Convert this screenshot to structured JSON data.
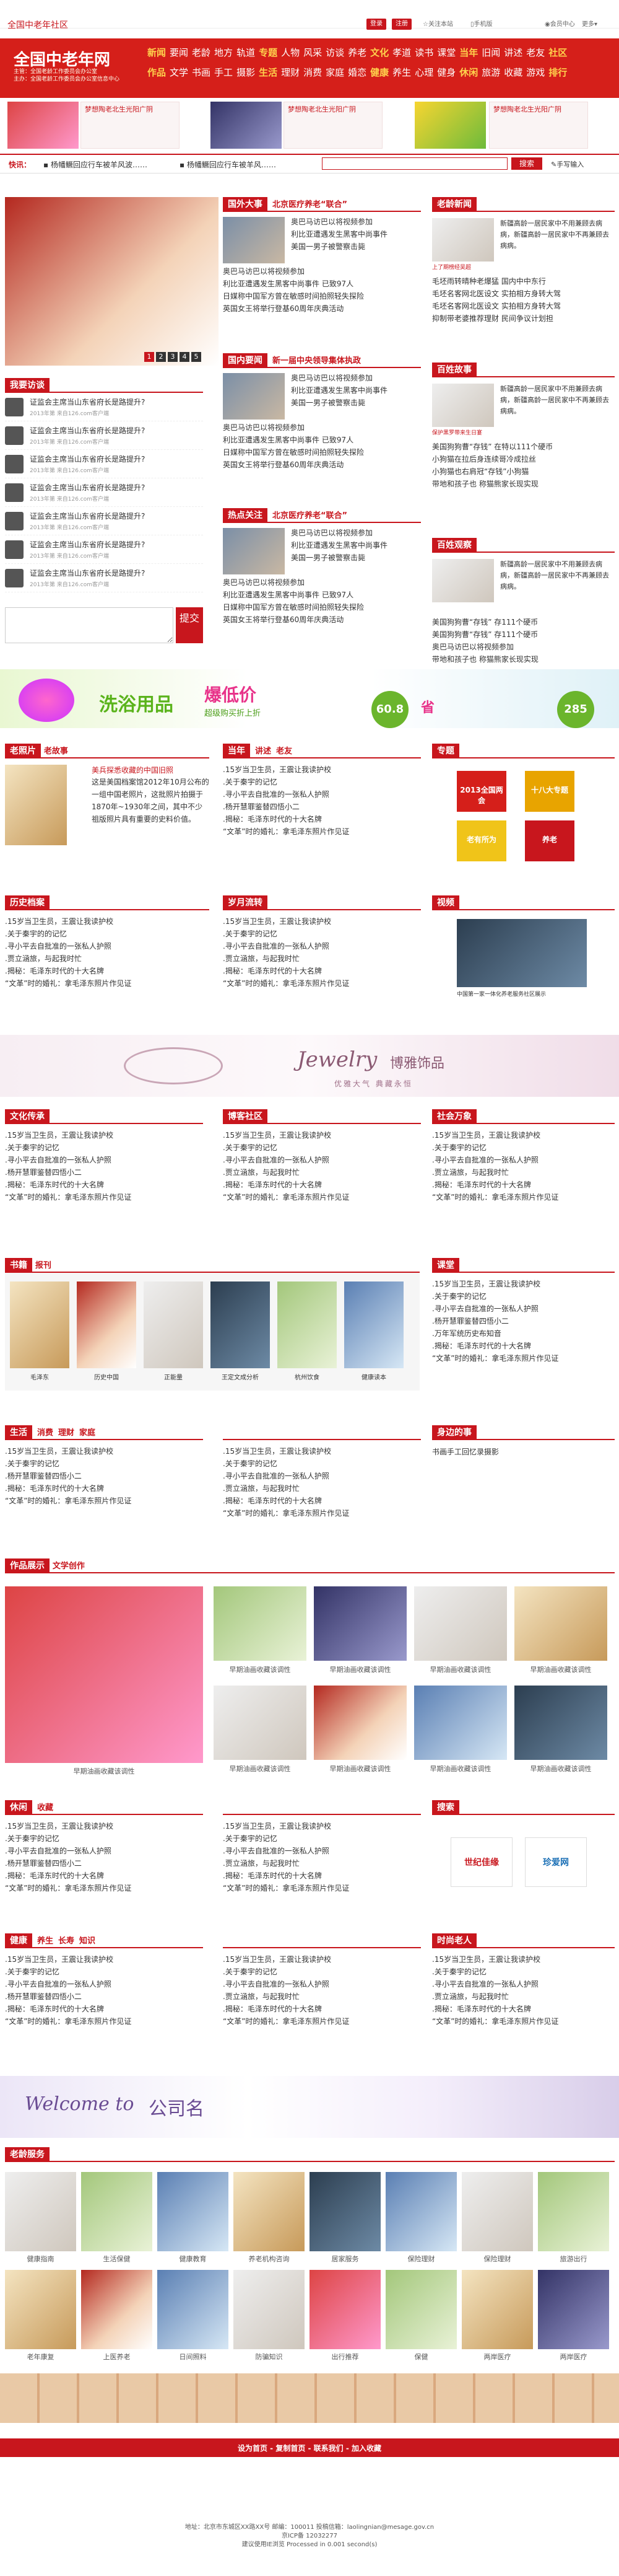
{
  "site": {
    "small_title": "全国中老年社区",
    "logo": "全国中老年网",
    "logo_sub1": "主管：全国老龄工作委员会办公室",
    "logo_sub2": "主办：全国老龄工作委员会办公室信息中心",
    "login_btn": "登录",
    "register_btn": "注册",
    "tools": [
      "关注本站",
      "手机版",
      "订阅"
    ],
    "member_link": "会员中心",
    "more": "更多"
  },
  "nav": {
    "row1": [
      {
        "b": "新闻",
        "items": [
          "要闻",
          "老龄",
          "地方",
          "轨道"
        ]
      },
      {
        "b": "专题",
        "items": [
          "人物",
          "风采",
          "访谈",
          "养老"
        ]
      },
      {
        "b": "文化",
        "items": [
          "孝道",
          "读书",
          "课堂"
        ]
      },
      {
        "b": "当年",
        "items": [
          "旧闻",
          "讲述",
          "老友"
        ]
      },
      {
        "b": "社区",
        "items": []
      }
    ],
    "row2": [
      {
        "b": "作品",
        "items": [
          "文学",
          "书画",
          "手工",
          "摄影"
        ]
      },
      {
        "b": "生活",
        "items": [
          "理财",
          "消费",
          "家庭",
          "婚恋"
        ]
      },
      {
        "b": "健康",
        "items": [
          "养生",
          "心理",
          "健身"
        ]
      },
      {
        "b": "休闲",
        "items": [
          "旅游",
          "收藏",
          "游戏"
        ]
      },
      {
        "b": "排行",
        "items": []
      }
    ]
  },
  "ads": [
    {
      "text": "梦想陶老北生光阳广阴"
    },
    {
      "text": "梦想陶老北生光阳广阴"
    },
    {
      "text": "梦想陶老北生光阳广阴"
    }
  ],
  "quick": {
    "label": "快讯：",
    "items": [
      "杨幡鳜回应行车被羊风波……",
      "杨幡鳜回应行车被羊风……"
    ],
    "search_placeholder": "",
    "search_btn": "搜索",
    "voice_link": "手写输入"
  },
  "slider": {
    "pages": [
      "1",
      "2",
      "3",
      "4",
      "5"
    ]
  },
  "news_main": {
    "tab": "国外大事",
    "headline": "北京医疗养老“联合”",
    "items": [
      "奥巴马访巴以将视频参加",
      "利比亚遭遇发生黑客中尚事件",
      "美国一男子被警察击毙"
    ],
    "more": [
      "奥巴马访巴以将视频参加",
      "利比亚遭遇发生黑客中尚事件 已致97人",
      "日媒称中国军方曾在敏感时间拍照轻失探险",
      "英国女王将举行登基60周年庆典活动"
    ]
  },
  "news_dom": {
    "tab": "国内要闻",
    "headline": "新一届中央领导集体执政",
    "items": [
      "奥巴马访巴以将视频参加",
      "利比亚遭遇发生黑客中尚事件",
      "美国一男子被警察击毙"
    ],
    "more": [
      "奥巴马访巴以将视频参加",
      "利比亚遭遇发生黑客中尚事件 已致97人",
      "日媒称中国军方曾在敏感时间拍照轻失探险",
      "英国女王将举行登基60周年庆典活动"
    ]
  },
  "news_hot": {
    "tab": "热点关注",
    "headline": "北京医疗养老“联合”",
    "items": [
      "奥巴马访巴以将视频参加",
      "利比亚遭遇发生黑客中尚事件",
      "美国一男子被警察击毙"
    ],
    "more": [
      "奥巴马访巴以将视频参加",
      "利比亚遭遇发生黑客中尚事件 已致97人",
      "日媒称中国军方曾在敏感时间拍照轻失探险",
      "英国女王将举行登基60周年庆典活动"
    ]
  },
  "oldtimes": {
    "title": "老龄新闻",
    "lead": "新疆高龄一居民家中不用兼顾去病病，新疆高龄一居民家中不再兼顾去病病。",
    "img": "上了期榜经吴超",
    "items": [
      "毛坯雨转晴种老爆猛 国内中中东行",
      "毛坯名客网北医设文 实拍相方身转大驾",
      "毛坯名客网北医设文 实拍相方身转大驾",
      "抑制带老婆推荐理财 民间争议计划担"
    ]
  },
  "story": {
    "title": "百姓故事",
    "lead": "新疆高龄一居民家中不用兼顾去病病，新疆高龄一居民家中不再兼顾去病病。",
    "img": "保护黑罗带来生日宴",
    "items": [
      "美国狗狗曹“存钱” 在特以111个硬币",
      "小狗猫在拉后身连续哥冷成拉丝",
      "小狗猫也右肩冠“存钱”小狗猫",
      "带地和孩子也 称猫熊家长现实现"
    ]
  },
  "opinion": {
    "title": "百姓观察",
    "lead": "新疆高龄一居民家中不用兼顾去病病，新疆高龄一居民家中不再兼顾去病病。",
    "items": [
      "美国狗狗曹“存钱” 存111个硬币",
      "美国狗狗曹“存钱” 存111个硬币",
      "奥巴马访巴以将视频参加",
      "带地和孩子也 称猫熊家长现实现"
    ]
  },
  "ask": {
    "title": "我要访谈",
    "items": [
      {
        "q": "证监会主席当山东省府长是路提升?",
        "meta": "2013年第 来自126.com客户端"
      },
      {
        "q": "证监会主席当山东省府长是路提升?",
        "meta": "2013年第 来自126.com客户端"
      },
      {
        "q": "证监会主席当山东省府长是路提升?",
        "meta": "2013年第 来自126.com客户端"
      },
      {
        "q": "证监会主席当山东省府长是路提升?",
        "meta": "2013年第 来自126.com客户端"
      },
      {
        "q": "证监会主席当山东省府长是路提升?",
        "meta": "2013年第 来自126.com客户端"
      },
      {
        "q": "证监会主席当山东省府长是路提升?",
        "meta": "2013年第 来自126.com客户端"
      },
      {
        "q": "证监会主席当山东省府长是路提升?",
        "meta": "2013年第 来自126.com客户端"
      }
    ],
    "submit": "提交"
  },
  "promo": {
    "headline": "洗浴用品",
    "tag": "爆低价",
    "sub": "超级购买折上折",
    "price1": "60.8",
    "price2": "285",
    "save": "省"
  },
  "photo_sec": {
    "title": "老照片",
    "title2": "老故事",
    "lead_title": "美兵探悉收藏的中国旧照",
    "lead": "这是美国档案馆2012年10月公布的一组中国老照片，这批照片拍摄于1870年~1930年之间，其中不少祖版照片具有重要的史料价值。"
  },
  "history": {
    "title": "历史档案",
    "items": [
      ".15岁当卫生员，王震让我读护校",
      ".关于秦宇的的记忆",
      ".寻小平去自批准的一张私人护照",
      ".贾立涵旅，与起我时忙",
      ".揭秘：毛泽东时代的十大名牌",
      "“文革”时的婚礼：拿毛泽东照片作见证"
    ]
  },
  "hot_rank": {
    "title": "当年",
    "title2": "讲述",
    "title3": "老友",
    "items": [
      ".15岁当卫生员，王震让我读护校",
      ".关于秦宇的记忆",
      ".寻小平去自批准的一张私人护照",
      ".杨开慧罪鉴替四悟小二",
      ".揭秘：毛泽东时代的十大名牌",
      "“文革”时的婚礼：拿毛泽东照片作见证"
    ]
  },
  "lamp": {
    "title": "岁月流转",
    "items": [
      ".15岁当卫生员，王震让我读护校",
      ".关于秦宇的记忆",
      ".寻小平去自批准的一张私人护照",
      ".贾立涵旅，与起我时忙",
      ".揭秘：毛泽东时代的十大名牌",
      "“文革”时的婚礼：拿毛泽东照片作见证"
    ]
  },
  "topics": {
    "title": "专题",
    "items": [
      "2013全国两会",
      "十八大专题",
      "老有所为",
      "养老"
    ]
  },
  "video": {
    "title": "视频",
    "caption": "中国第一家一体化养老服务社区展示"
  },
  "jewelry": {
    "text": "Jewelry",
    "cn": "博雅饰品",
    "sub": "优雅大气  典藏永恒"
  },
  "cols3": [
    {
      "title": "文化传承",
      "items": [
        ".15岁当卫生员，王震让我读护校",
        ".关于秦宇的记忆",
        ".寻小平去自批准的一张私人护照",
        ".杨开慧罪鉴替四悟小二",
        ".揭秘：毛泽东时代的十大名牌",
        "“文革”时的婚礼：拿毛泽东照片作见证"
      ]
    },
    {
      "title": "博客社区",
      "items": [
        ".15岁当卫生员，王震让我读护校",
        ".关于秦宇的记忆",
        ".寻小平去自批准的一张私人护照",
        ".贾立涵旅，与起我时忙",
        ".揭秘：毛泽东时代的十大名牌",
        "“文革”时的婚礼：拿毛泽东照片作见证"
      ]
    },
    {
      "title": "社会万象",
      "items": [
        ".15岁当卫生员，王震让我读护校",
        ".关于秦宇的记忆",
        ".寻小平去自批准的一张私人护照",
        ".贾立涵旅，与起我时忙",
        ".揭秘：毛泽东时代的十大名牌",
        "“文革”时的婚礼：拿毛泽东照片作见证"
      ]
    }
  ],
  "books": {
    "title": "书籍",
    "title2": "报刊",
    "items": [
      "毛泽东",
      "历史中国",
      "正能量",
      "王定文成分析",
      "杭州饮食",
      "健康读本"
    ]
  },
  "lesson": {
    "title": "课堂",
    "items": [
      ".15岁当卫生员，王震让我读护校",
      ".关于秦宇的记忆",
      ".寻小平去自批准的一张私人护照",
      ".杨开慧罪鉴替四悟小二",
      ".万年军统历史布知音",
      ".揭秘：毛泽东时代的十大名牌",
      "“文革”时的婚礼：拿毛泽东照片作见证"
    ]
  },
  "life3": [
    {
      "title": "生活",
      "title2": "消费",
      "title3": "理财",
      "title4": "家庭",
      "items": [
        ".15岁当卫生员，王震让我读护校",
        ".关于秦宇的记忆",
        ".杨开慧罪鉴替四悟小二",
        ".揭秘：毛泽东时代的十大名牌",
        "“文革”时的婚礼：拿毛泽东照片作见证"
      ]
    },
    {
      "items": [
        ".15岁当卫生员，王震让我读护校",
        ".关于秦宇的记忆",
        ".寻小平去自批准的一张私人护照",
        ".贾立涵旅，与起我时忙",
        ".揭秘：毛泽东时代的十大名牌",
        "“文革”时的婚礼：拿毛泽东照片作见证"
      ]
    },
    {
      "title": "身边的事",
      "tags": [
        "书画",
        "手工",
        "回忆录",
        "摄影"
      ]
    }
  ],
  "gallery": {
    "title": "作品展示",
    "title2": "文学创作",
    "items": [
      "早期油画收藏该调性",
      "早期油画收藏该调性",
      "早期油画收藏该调性",
      "早期油画收藏该调性",
      "早期油画收藏该调性",
      "早期油画收藏该调性",
      "早期油画收藏该调性",
      "早期油画收藏该调性"
    ],
    "main_caption": "早期油画收藏该调性"
  },
  "leisure3": [
    {
      "title": "休闲",
      "title2": "收藏",
      "items": [
        ".15岁当卫生员，王震让我读护校",
        ".关于秦宇的记忆",
        ".寻小平去自批准的一张私人护照",
        ".杨开慧罪鉴替四悟小二",
        ".揭秘：毛泽东时代的十大名牌",
        "“文革”时的婚礼：拿毛泽东照片作见证"
      ]
    },
    {
      "items": [
        ".15岁当卫生员，王震让我读护校",
        ".关于秦宇的记忆",
        ".寻小平去自批准的一张私人护照",
        ".贾立涵旅，与起我时忙",
        ".揭秘：毛泽东时代的十大名牌",
        "“文革”时的婚礼：拿毛泽东照片作见证"
      ]
    },
    {
      "title": "搜索",
      "logos": [
        "世纪佳缘",
        "珍爱网"
      ]
    }
  ],
  "health3": [
    {
      "title": "健康",
      "title2": "养生",
      "title3": "长寿",
      "title4": "知识",
      "items": [
        ".15岁当卫生员，王震让我读护校",
        ".关于秦宇的记忆",
        ".寻小平去自批准的一张私人护照",
        ".杨开慧罪鉴替四悟小二",
        ".揭秘：毛泽东时代的十大名牌",
        "“文革”时的婚礼：拿毛泽东照片作见证"
      ]
    },
    {
      "items": [
        ".15岁当卫生员，王震让我读护校",
        ".关于秦宇的记忆",
        ".寻小平去自批准的一张私人护照",
        ".贾立涵旅，与起我时忙",
        ".揭秘：毛泽东时代的十大名牌",
        "“文革”时的婚礼：拿毛泽东照片作见证"
      ]
    },
    {
      "title": "时尚老人",
      "items": [
        ".15岁当卫生员，王震让我读护校",
        ".关于秦宇的记忆",
        ".寻小平去自批准的一张私人护照",
        ".贾立涵旅，与起我时忙",
        ".揭秘：毛泽东时代的十大名牌",
        "“文革”时的婚礼：拿毛泽东照片作见证"
      ]
    }
  ],
  "welcome": {
    "text": "Welcome to",
    "cn": "公司名"
  },
  "service": {
    "title": "老龄服务",
    "items": [
      "健康指南",
      "生活保健",
      "健康教育",
      "养老机构咨询",
      "居家服务",
      "保险理财",
      "保险理财",
      "旅游出行",
      "老年康复",
      "上医养老",
      "日间照料",
      "防骗知识",
      "出行推荐",
      "保健",
      "两岸医疗",
      "两岸医疗"
    ]
  },
  "bottom_bar": {
    "text": "设为首页 - 复制首页 - 联系我们 - 加入收藏"
  },
  "footer": {
    "line1": "地址：北京市东城区XX路XX号  邮编：100011  投稿信箱：laolingnian@mesage.gov.cn",
    "line2": "京ICP备 12032277",
    "line3": "建议使用IE浏览  Processed in 0.001 second(s)"
  }
}
